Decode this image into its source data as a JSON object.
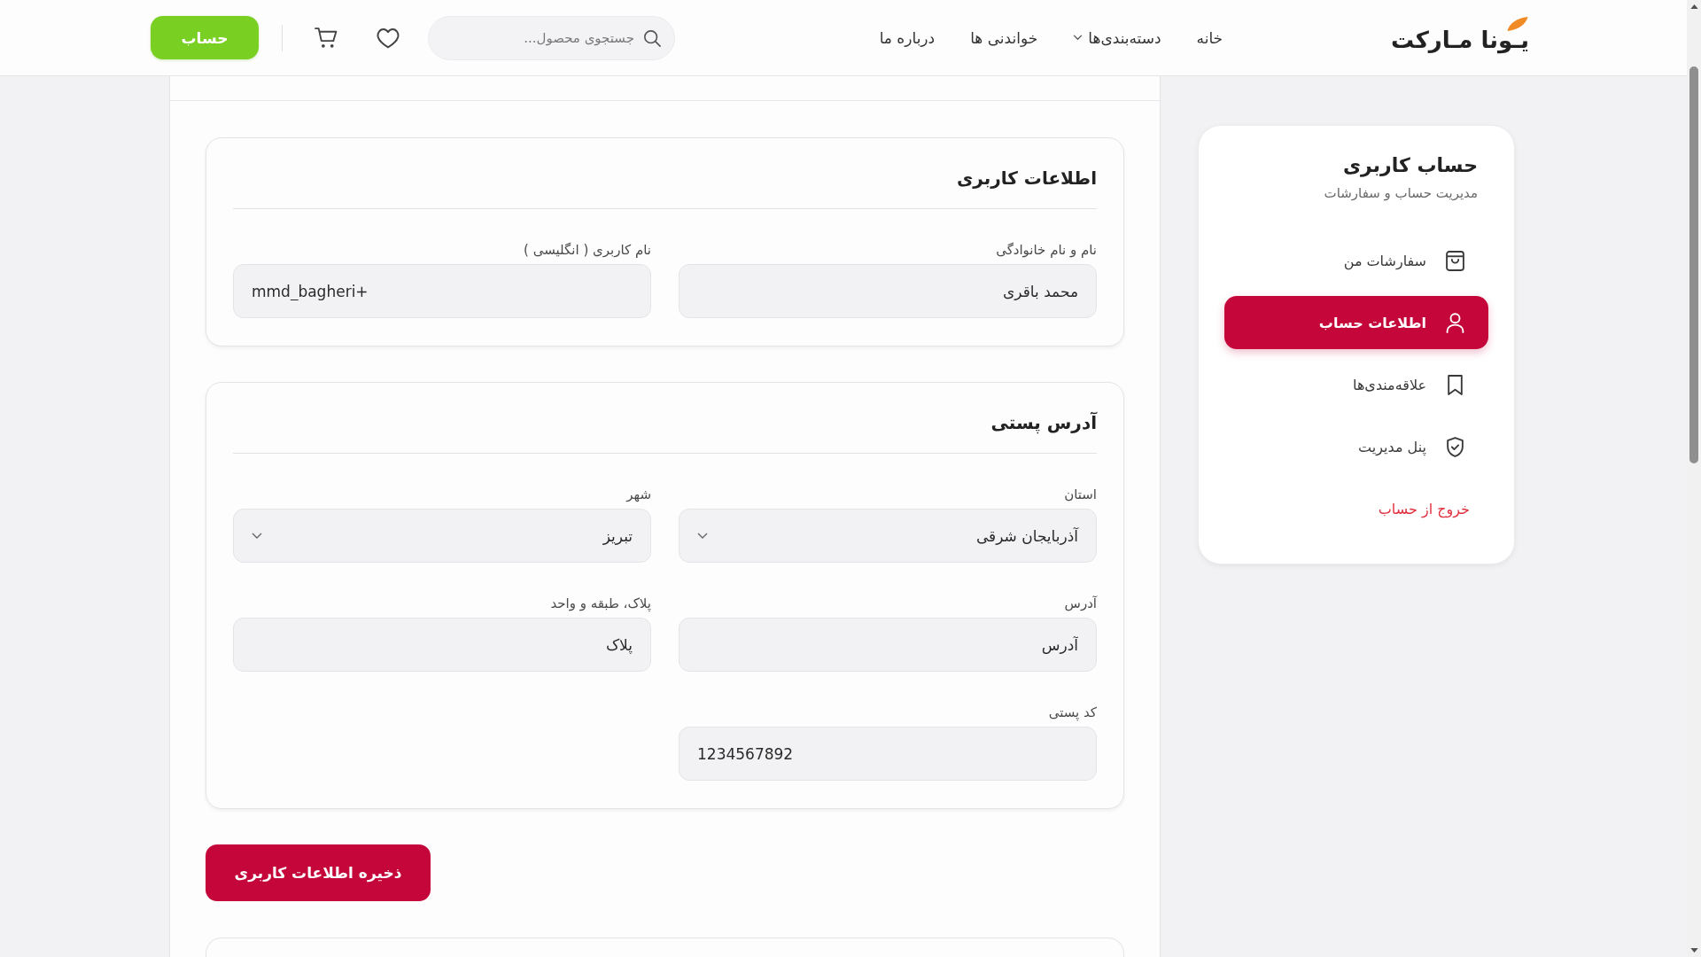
{
  "header": {
    "logo": "یـونا مـارکت",
    "nav": [
      {
        "label": "خانه",
        "has_dropdown": false
      },
      {
        "label": "دسته‌بندی‌ها",
        "has_dropdown": true
      },
      {
        "label": "خواندنی ها",
        "has_dropdown": false
      },
      {
        "label": "درباره ما",
        "has_dropdown": false
      }
    ],
    "search": {
      "placeholder": "جستجوی محصول..."
    },
    "account_button": "حساب"
  },
  "sidebar": {
    "title": "حساب کاربری",
    "subtitle": "مدیریت حساب و سفارشات",
    "items": [
      {
        "label": "سفارشات من",
        "kind": "orders",
        "selected": false
      },
      {
        "label": "اطلاعات حساب",
        "kind": "account",
        "selected": true
      },
      {
        "label": "علاقه‌مندی‌ها",
        "kind": "favorites",
        "selected": false
      },
      {
        "label": "پنل مدیریت",
        "kind": "admin",
        "selected": false
      },
      {
        "label": "خروج از حساب",
        "kind": "logout",
        "selected": false
      }
    ]
  },
  "form": {
    "sections": [
      {
        "title": "اطلاعات کاربری",
        "fields": [
          {
            "label": "نام و نام خانوادگی",
            "kind": "text",
            "value": "محمد باقری"
          },
          {
            "label": "نام کاربری ( انگلیسی )",
            "kind": "text",
            "value": "mmd_bagheri+"
          }
        ]
      },
      {
        "title": "آدرس پستی",
        "fields": [
          {
            "label": "استان",
            "kind": "select",
            "value": "آذربایجان شرقی"
          },
          {
            "label": "شهر",
            "kind": "select",
            "value": "تبریز"
          },
          {
            "label": "آدرس",
            "kind": "text",
            "value": "آدرس"
          },
          {
            "label": "پلاک، طبقه و واحد",
            "kind": "text",
            "value": "پلاک"
          },
          {
            "label": "کد پستی",
            "kind": "text",
            "value": "1234567892"
          }
        ]
      }
    ],
    "save_button": "ذخیره اطلاعات کاربری"
  }
}
